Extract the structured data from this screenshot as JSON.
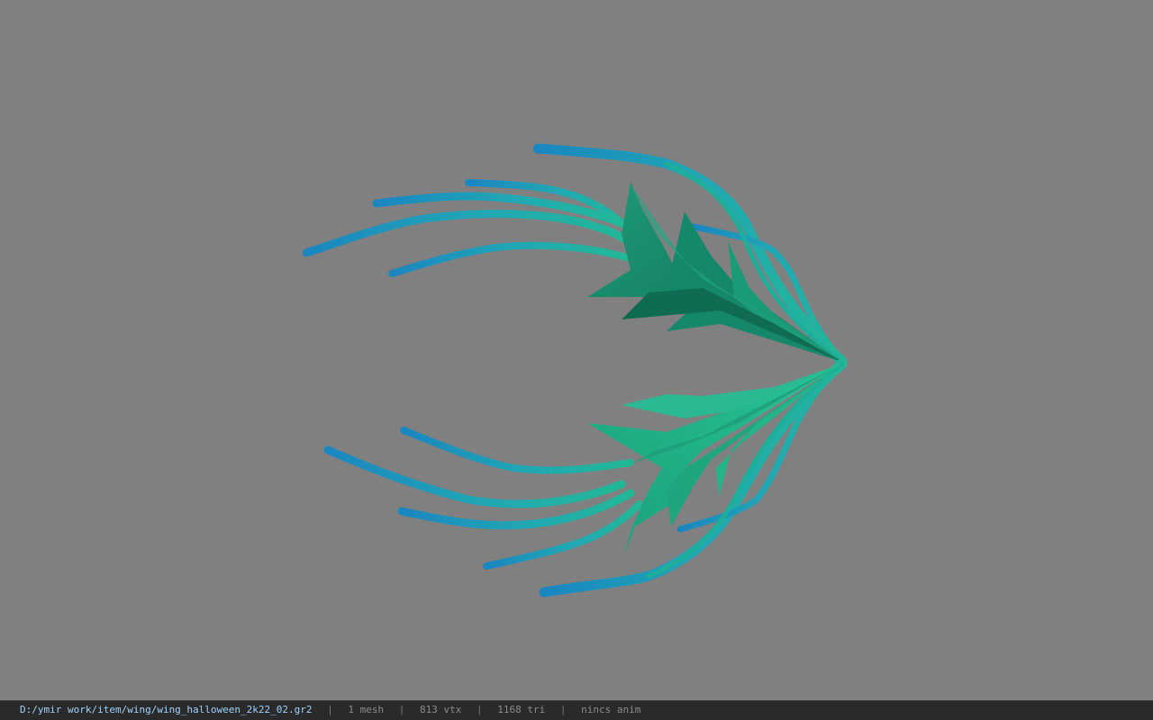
{
  "viewport": {
    "background": "#808080",
    "model": {
      "description_name": "wing-model",
      "colors": {
        "strand_tip": "#1f8fc2",
        "strand_mid": "#1fb79a",
        "leaf_dark": "#0f6e54",
        "leaf_light": "#23b887"
      }
    }
  },
  "statusbar": {
    "path": "D:/ymir work/item/wing/wing_halloween_2k22_02.gr2",
    "sep": "|",
    "mesh": "1 mesh",
    "vtx": "813 vtx",
    "tri": "1168 tri",
    "anim": "nincs anim"
  }
}
